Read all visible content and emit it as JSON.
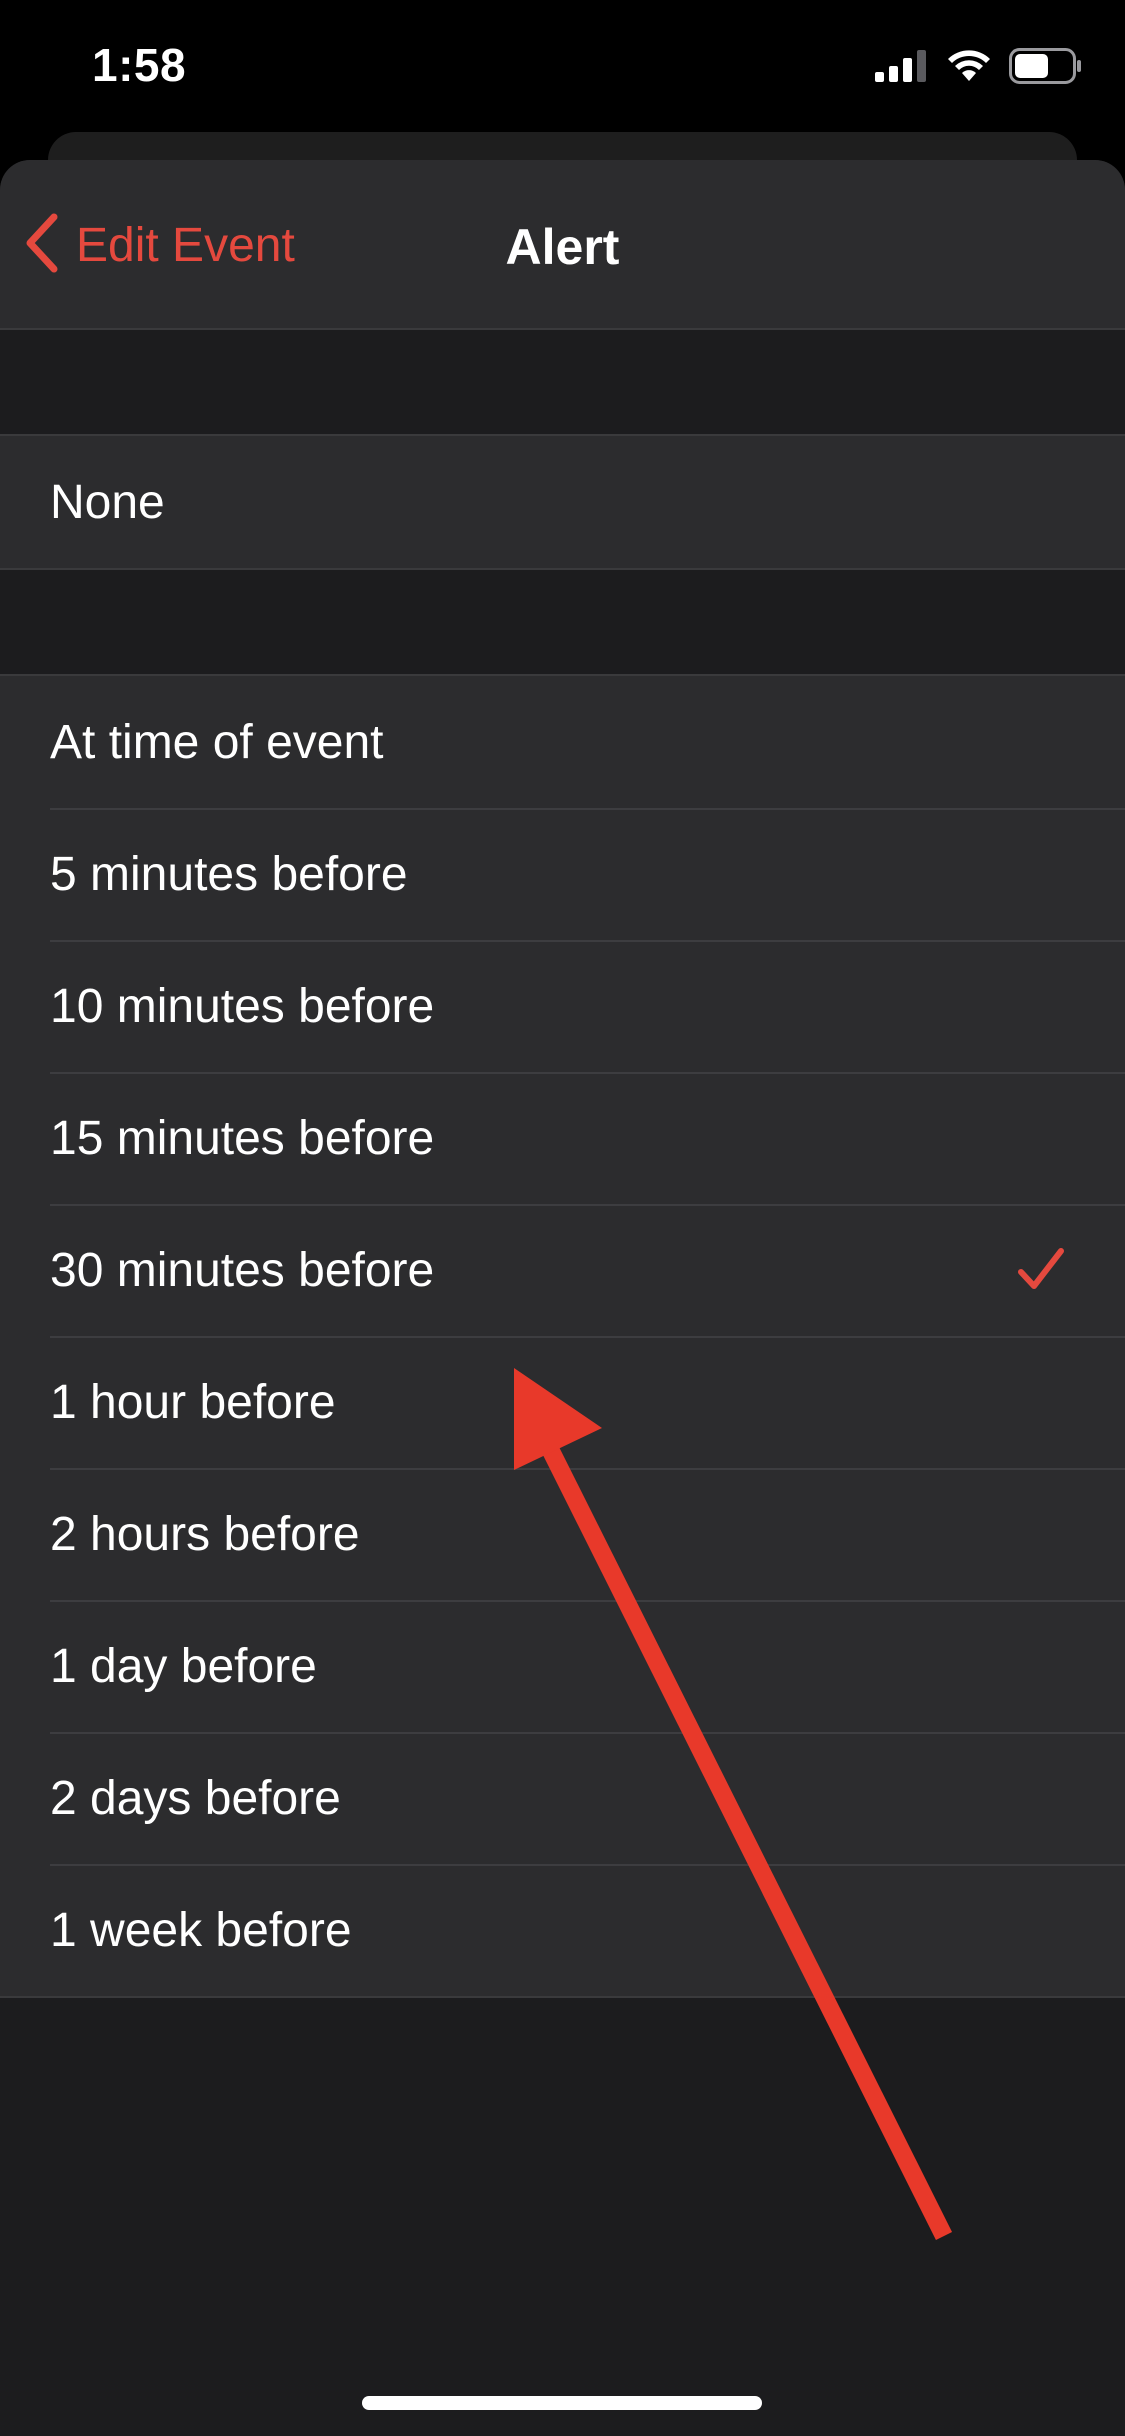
{
  "status_bar": {
    "time": "1:58",
    "icons": [
      "signal-icon",
      "wifi-icon",
      "battery-icon"
    ]
  },
  "nav": {
    "back_label": "Edit Event",
    "title": "Alert"
  },
  "none_group": [
    {
      "label": "None",
      "selected": false
    }
  ],
  "alert_options": [
    {
      "label": "At time of event",
      "selected": false
    },
    {
      "label": "5 minutes before",
      "selected": false
    },
    {
      "label": "10 minutes before",
      "selected": false
    },
    {
      "label": "15 minutes before",
      "selected": false
    },
    {
      "label": "30 minutes before",
      "selected": true
    },
    {
      "label": "1 hour before",
      "selected": false
    },
    {
      "label": "2 hours before",
      "selected": false
    },
    {
      "label": "1 day before",
      "selected": false
    },
    {
      "label": "2 days before",
      "selected": false
    },
    {
      "label": "1 week before",
      "selected": false
    }
  ],
  "colors": {
    "accent": "#e5493e",
    "annotation_arrow": "#e8392a",
    "background": "#1c1c1e",
    "cell": "#2c2c2e"
  }
}
